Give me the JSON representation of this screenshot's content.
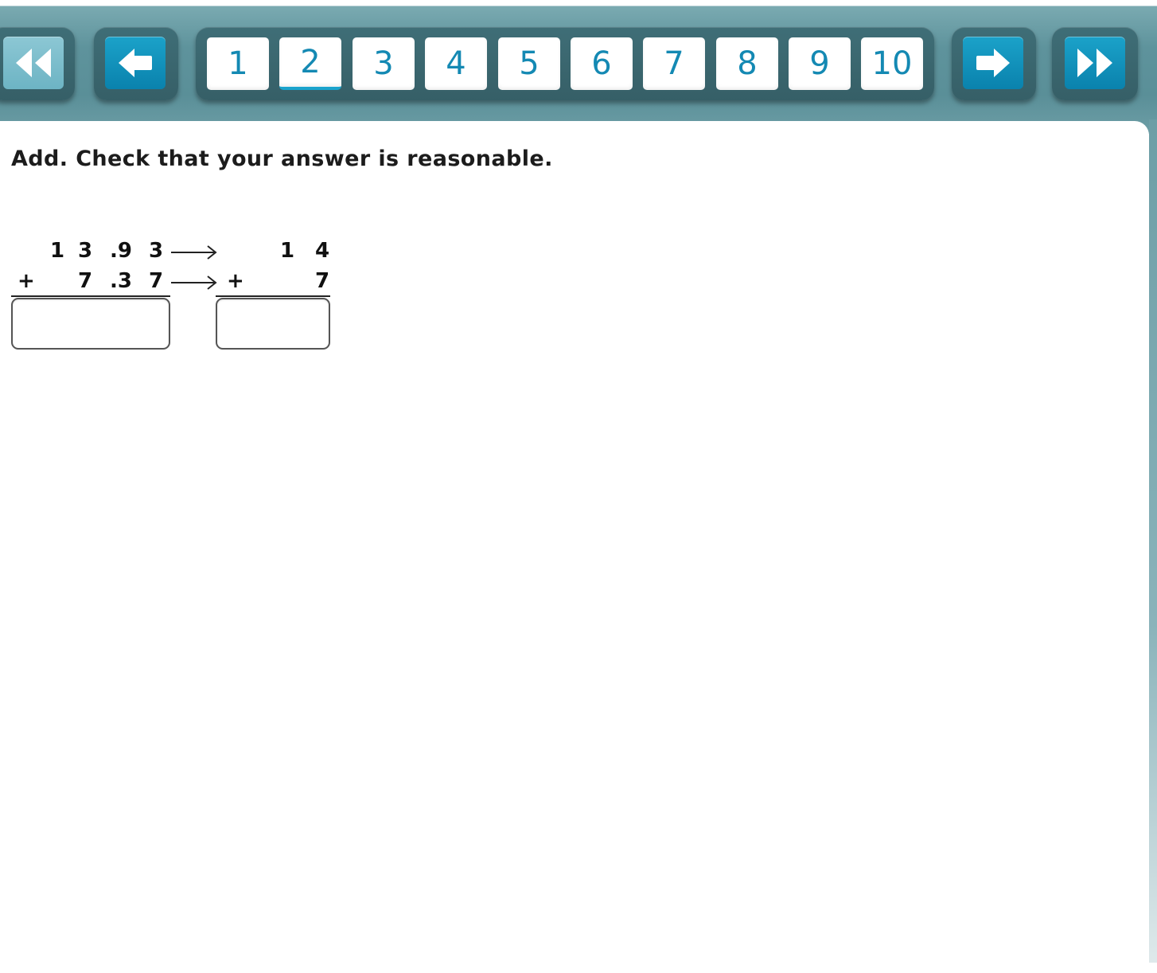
{
  "nav": {
    "first_icon": "double-left-arrow-icon",
    "prev_icon": "left-arrow-icon",
    "next_icon": "right-arrow-icon",
    "last_icon": "double-right-arrow-icon",
    "pages": [
      "1",
      "2",
      "3",
      "4",
      "5",
      "6",
      "7",
      "8",
      "9",
      "10"
    ],
    "current_page": "2",
    "accent_color": "#1489b3"
  },
  "problem": {
    "instruction": "Add. Check that your answer is reasonable.",
    "exact": {
      "row1": [
        "1",
        "3",
        ".9",
        "3"
      ],
      "row2_sign": "+",
      "row2": [
        "7",
        ".3",
        "7"
      ],
      "answer_value": ""
    },
    "estimate": {
      "row1": [
        "1",
        "4"
      ],
      "row2_sign": "+",
      "row2": [
        "7"
      ],
      "answer_value": ""
    }
  }
}
